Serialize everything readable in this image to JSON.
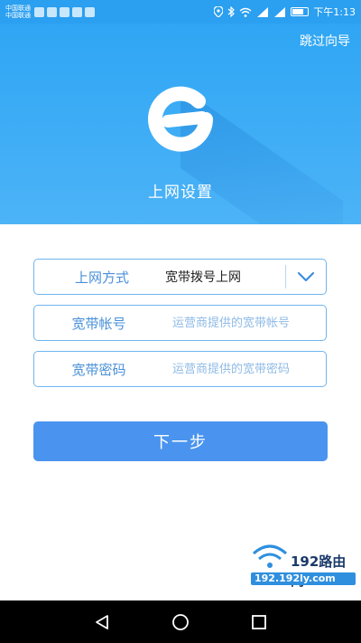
{
  "status_bar": {
    "carrier_1": "中国联通",
    "carrier_2": "中国联通",
    "time": "下午1:13"
  },
  "header": {
    "skip_label": "跳过向导",
    "title": "上网设置"
  },
  "form": {
    "mode": {
      "label": "上网方式",
      "value": "宽带拨号上网"
    },
    "account": {
      "label": "宽带帐号",
      "placeholder": "运营商提供的宽带帐号"
    },
    "password": {
      "label": "宽带密码",
      "placeholder": "运营商提供的宽带密码"
    }
  },
  "next_button": {
    "label": "下一步"
  },
  "watermark": {
    "brand": "192路由网",
    "domain": "192.192ly.com"
  },
  "colors": {
    "header_blue": "#2fa6f4",
    "accent_blue": "#4a94ef",
    "border_blue": "#6fb5ef"
  },
  "icons": {
    "logo": "e-logo-icon",
    "dropdown": "chevron-down-icon",
    "back": "back-triangle-icon",
    "home": "home-circle-icon",
    "recents": "recents-square-icon"
  }
}
